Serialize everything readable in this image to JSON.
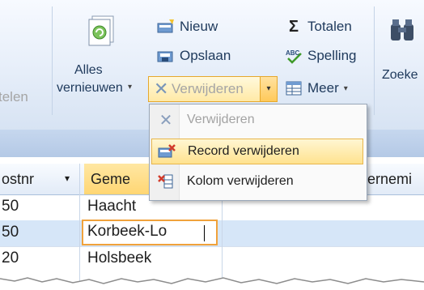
{
  "ribbon": {
    "partial_left": "telen",
    "refresh_label_line1": "Alles",
    "refresh_label_line2": "vernieuwen",
    "refresh_arrow": "▾",
    "new_label": "Nieuw",
    "save_label": "Opslaan",
    "delete_label": "Verwijderen",
    "delete_arrow": "▾",
    "totals_label": "Totalen",
    "spelling_label": "Spelling",
    "more_label": "Meer",
    "more_arrow": "▾",
    "find_label": "Zoeke",
    "sigma_glyph": "Σ",
    "x_glyph": "✕"
  },
  "grid": {
    "headers": {
      "col1": "ostnr",
      "col1_arrow": "▾",
      "col2": "Geme",
      "col3": "ernemi"
    },
    "rows": [
      {
        "postnr": "50",
        "gemeente": "Haacht",
        "selected": false
      },
      {
        "postnr": "50",
        "gemeente": "Korbeek-Lo",
        "selected": true
      },
      {
        "postnr": "20",
        "gemeente": "Holsbeek",
        "selected": false
      }
    ]
  },
  "dropdown_menu": {
    "items": [
      {
        "label": "Verwijderen",
        "enabled": false,
        "icon": "x-icon"
      },
      {
        "label": "Record verwijderen",
        "enabled": true,
        "highlighted": true,
        "icon": "delete-record-icon"
      },
      {
        "label": "Kolom verwijderen",
        "enabled": true,
        "icon": "delete-column-icon"
      }
    ]
  },
  "colors": {
    "ribbon_bg": "#e6eef9",
    "highlight": "#ffe28f",
    "highlight_border": "#e8b64c",
    "selection_row": "#d6e6f8",
    "edit_border": "#f0a23b"
  }
}
